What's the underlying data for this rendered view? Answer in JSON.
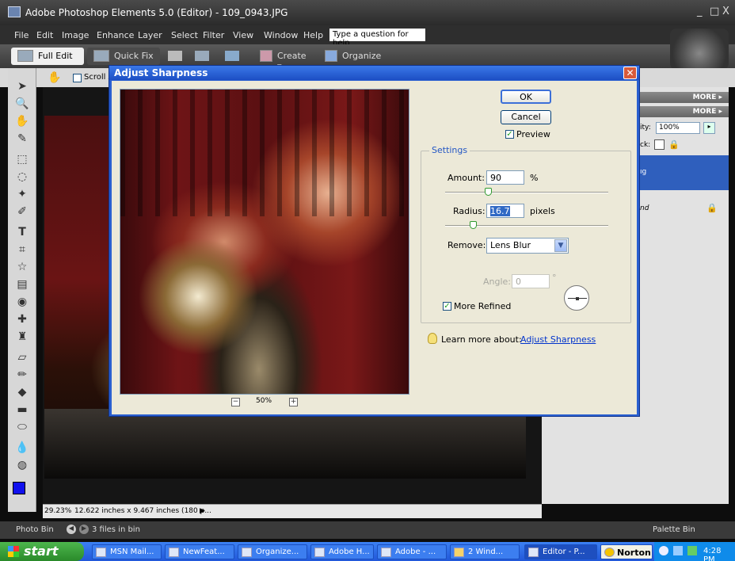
{
  "window": {
    "title": "Adobe Photoshop Elements 5.0 (Editor) - 109_0943.JPG",
    "controls": [
      "_",
      "□",
      "X"
    ]
  },
  "menu": {
    "items": [
      "File",
      "Edit",
      "Image",
      "Enhance",
      "Layer",
      "Select",
      "Filter",
      "View",
      "Window",
      "Help"
    ],
    "help_placeholder": "Type a question for help"
  },
  "shortcuts": {
    "full_edit": "Full Edit",
    "quick_fix": "Quick Fix",
    "create": "Create ▾",
    "organize": "Organize"
  },
  "options": {
    "scroll_all": "Scroll A"
  },
  "panels": {
    "more1": "MORE ▸",
    "more2": "MORE ▸",
    "opacity_label": "ity:",
    "opacity_value": "100%",
    "lock_label": "ck:",
    "layer1_text": "ıg",
    "layer2_text": "nd"
  },
  "status": {
    "zoom": "29.23%",
    "doc_size": "12.622 inches x 9.467 inches (180 p..."
  },
  "photo_bin": {
    "label": "Photo Bin",
    "files": "3 files in bin",
    "palette_bin": "Palette Bin"
  },
  "dialog": {
    "title": "Adjust Sharpness",
    "ok": "OK",
    "cancel": "Cancel",
    "preview_label": "Preview",
    "preview_zoom": "50%",
    "settings_legend": "Settings",
    "amount_label": "Amount:",
    "amount_value": "90",
    "amount_unit": "%",
    "amount_slider": 0.26,
    "radius_label": "Radius:",
    "radius_value": "16.7",
    "radius_unit": "pixels",
    "radius_slider": 0.17,
    "remove_label": "Remove:",
    "remove_value": "Lens Blur",
    "angle_label": "Angle:",
    "angle_value": "0",
    "angle_unit": "°",
    "more_refined_label": "More Refined",
    "learn_more": "Learn more about:",
    "learn_more_link": "Adjust Sharpness"
  },
  "taskbar": {
    "start": "start",
    "tasks": [
      "MSN Mail...",
      "NewFeat...",
      "Organize...",
      "Adobe H...",
      "Adobe - ...",
      "2 Wind...",
      "Editor - P..."
    ],
    "norton": "Norton",
    "clock": "4:28 PM"
  }
}
